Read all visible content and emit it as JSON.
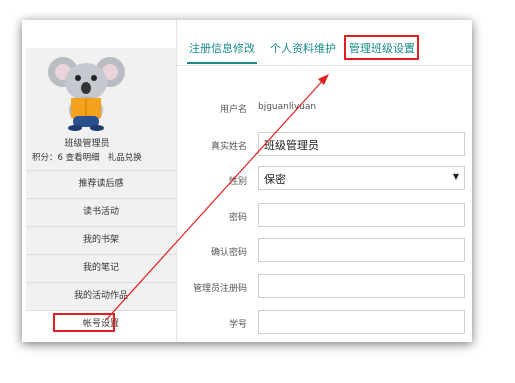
{
  "sidebar": {
    "username": "班级管理员",
    "points_label": "积分：6",
    "view_details": "查看明细",
    "gift_exchange": "礼品兑换",
    "items": [
      {
        "label": "推荐读后感"
      },
      {
        "label": "读书活动"
      },
      {
        "label": "我的书架"
      },
      {
        "label": "我的笔记"
      },
      {
        "label": "我的活动作品"
      },
      {
        "label": "帐号设置"
      }
    ]
  },
  "tabs": [
    {
      "label": "注册信息修改"
    },
    {
      "label": "个人资料维护"
    },
    {
      "label": "管理班级设置"
    }
  ],
  "form": {
    "username_label": "用户名",
    "username_value": "bjguanliyuan",
    "realname_label": "真实姓名",
    "realname_value": "班级管理员",
    "gender_label": "性别",
    "gender_value": "保密",
    "password_label": "密码",
    "confirm_label": "确认密码",
    "regcode_label": "管理员注册码",
    "studentid_label": "学号"
  },
  "colors": {
    "accent": "#1a8a8a",
    "highlight": "#e02020"
  }
}
